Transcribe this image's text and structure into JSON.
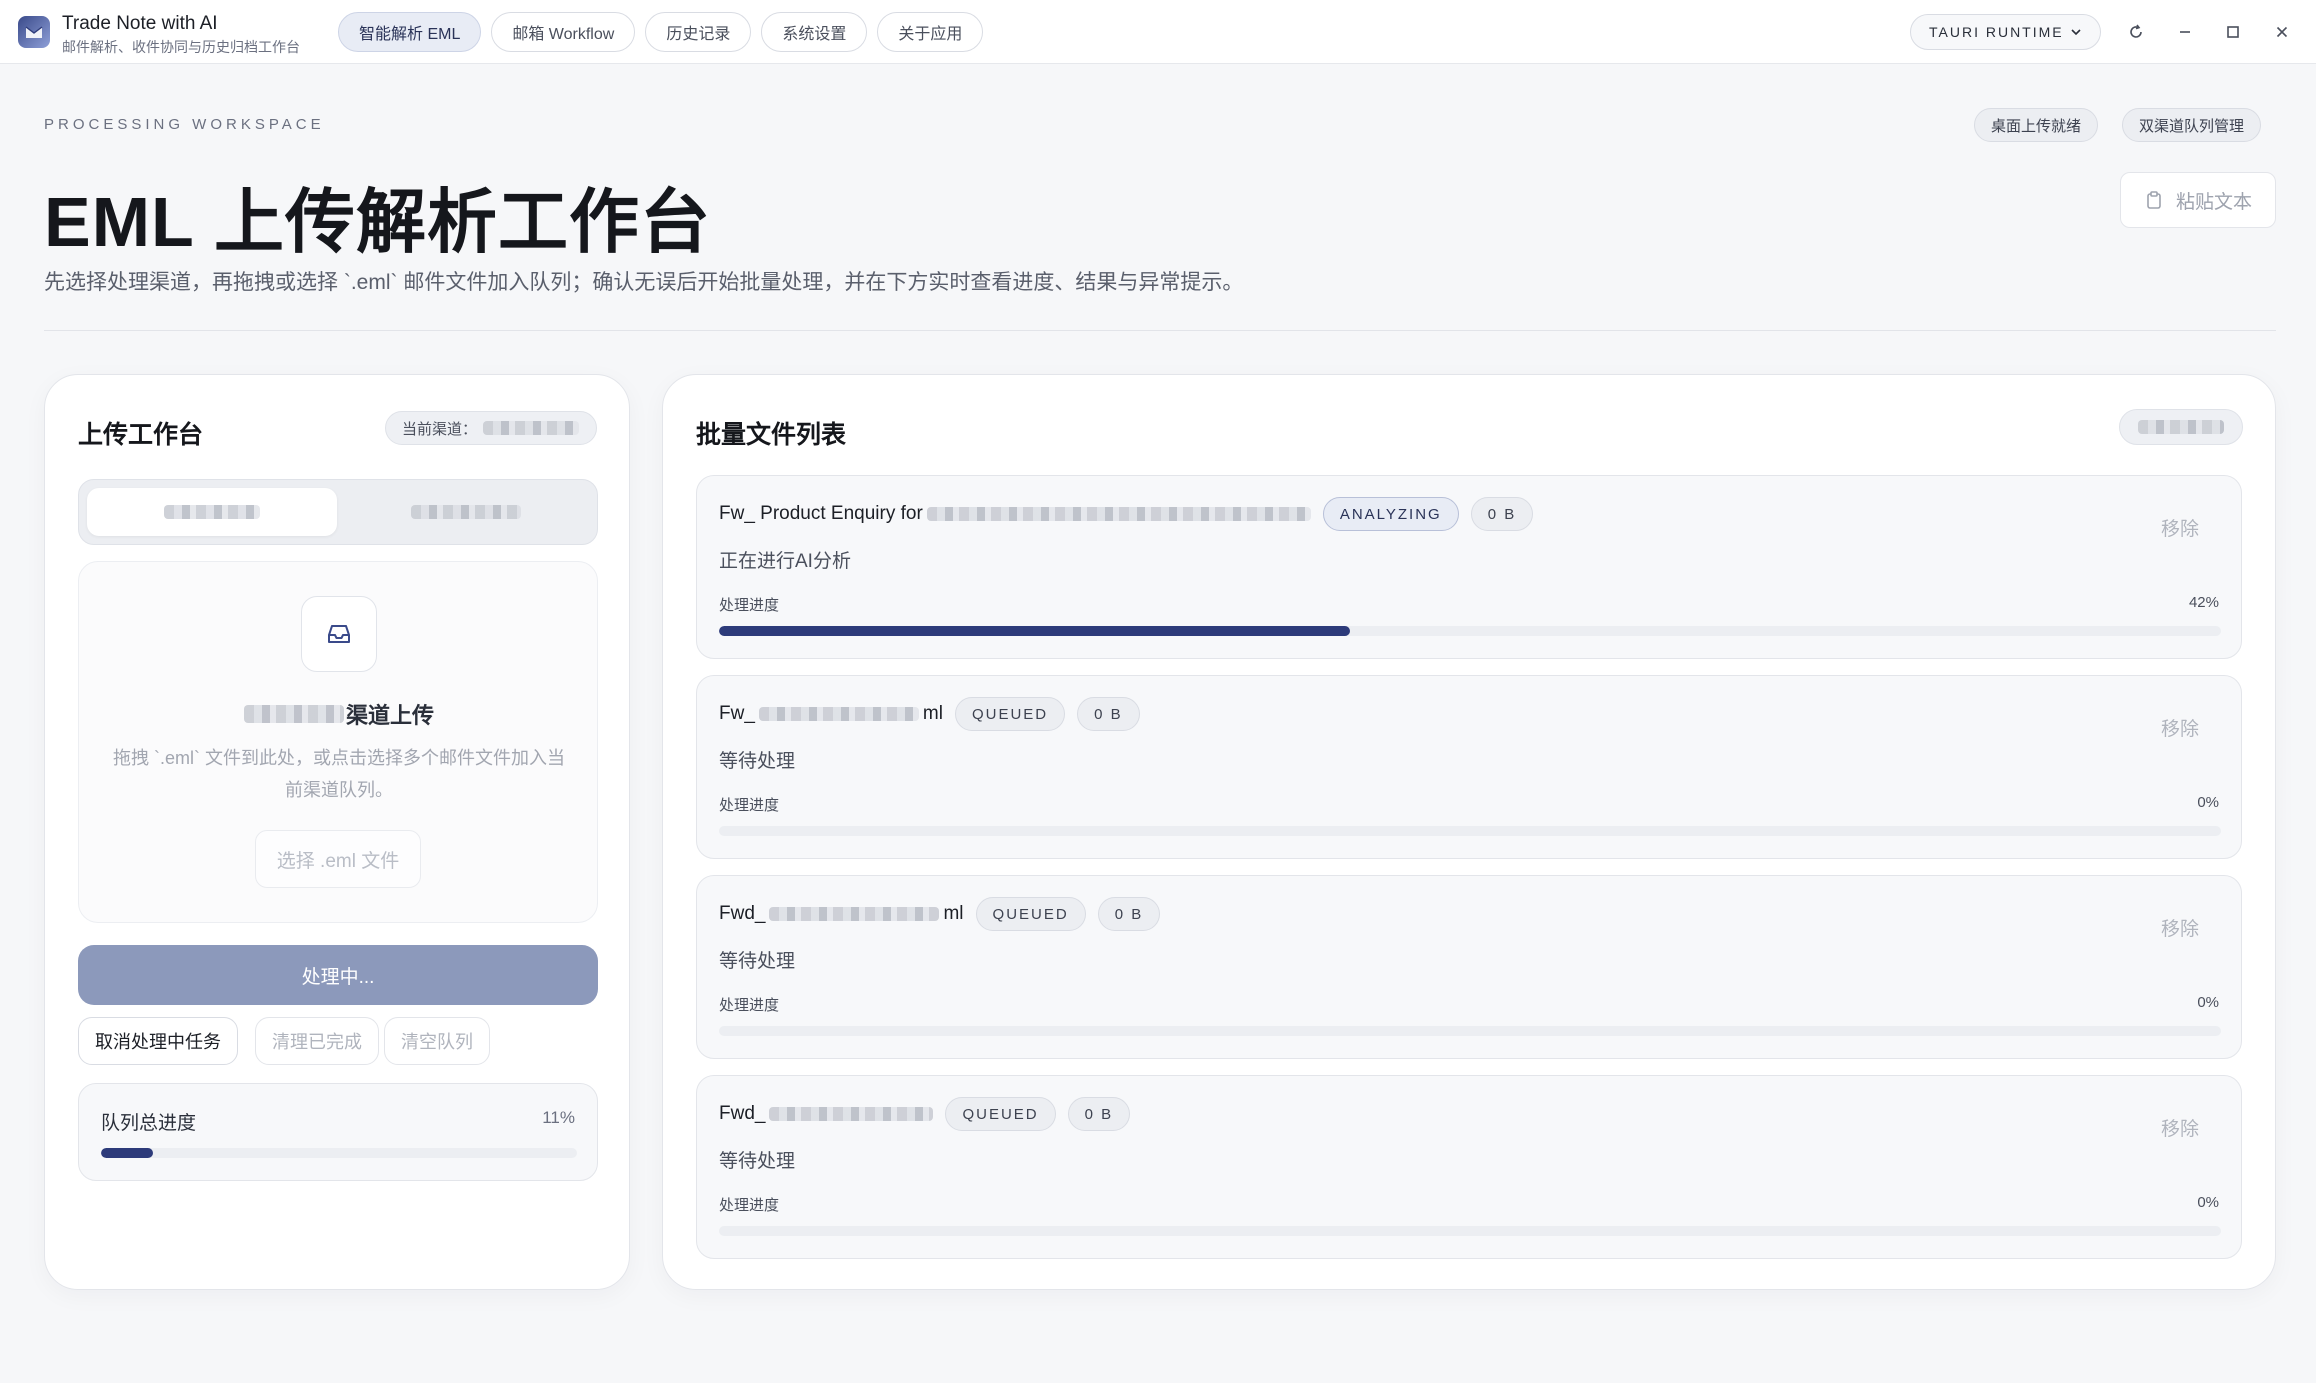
{
  "app": {
    "name": "Trade Note with AI",
    "subtitle": "邮件解析、收件协同与历史归档工作台"
  },
  "nav": {
    "items": [
      {
        "label": "智能解析 EML",
        "active": true
      },
      {
        "label": "邮箱 Workflow",
        "active": false
      },
      {
        "label": "历史记录",
        "active": false
      },
      {
        "label": "系统设置",
        "active": false
      },
      {
        "label": "关于应用",
        "active": false
      }
    ]
  },
  "runtime": {
    "label": "TAURI RUNTIME"
  },
  "header": {
    "eyebrow": "PROCESSING WORKSPACE",
    "title": "EML 上传解析工作台",
    "description": "先选择处理渠道，再拖拽或选择 `.eml` 邮件文件加入队列；确认无误后开始批量处理，并在下方实时查看进度、结果与异常提示。",
    "chips": [
      "桌面上传就绪",
      "双渠道队列管理"
    ],
    "paste_label": "粘贴文本"
  },
  "upload": {
    "title": "上传工作台",
    "channel_prefix": "当前渠道：",
    "drop_title_suffix": "渠道上传",
    "drop_hint": "拖拽 `.eml` 文件到此处，或点击选择多个邮件文件加入当前渠道队列。",
    "select_label": "选择 .eml 文件",
    "process_label": "处理中...",
    "actions": {
      "cancel": "取消处理中任务",
      "clear_done": "清理已完成",
      "clear_queue": "清空队列"
    },
    "total": {
      "label": "队列总进度",
      "percent_text": "11%",
      "percent": 11
    }
  },
  "batch": {
    "title": "批量文件列表",
    "progress_label": "处理进度",
    "remove_label": "移除",
    "files": [
      {
        "name_prefix": "Fw_ Product Enquiry for",
        "name_suffix": "",
        "status": "ANALYZING",
        "size": "0 B",
        "status_text": "正在进行AI分析",
        "percent_text": "42%",
        "percent": 42
      },
      {
        "name_prefix": "Fw_",
        "name_suffix": "ml",
        "status": "QUEUED",
        "size": "0 B",
        "status_text": "等待处理",
        "percent_text": "0%",
        "percent": 0
      },
      {
        "name_prefix": "Fwd_",
        "name_suffix": "ml",
        "status": "QUEUED",
        "size": "0 B",
        "status_text": "等待处理",
        "percent_text": "0%",
        "percent": 0
      },
      {
        "name_prefix": "Fwd_",
        "name_suffix": "",
        "status": "QUEUED",
        "size": "0 B",
        "status_text": "等待处理",
        "percent_text": "0%",
        "percent": 0
      }
    ]
  },
  "colors": {
    "accent": "#2d3b7a",
    "processing_button": "#8c99bb",
    "background": "#f6f7f9"
  },
  "icons": {
    "logo": "app-logo-icon",
    "refresh": "refresh-icon",
    "minimize": "minimize-icon",
    "maximize": "maximize-icon",
    "close": "close-icon",
    "paste": "clipboard-icon",
    "inbox": "inbox-icon",
    "chevron": "chevron-down-icon"
  }
}
